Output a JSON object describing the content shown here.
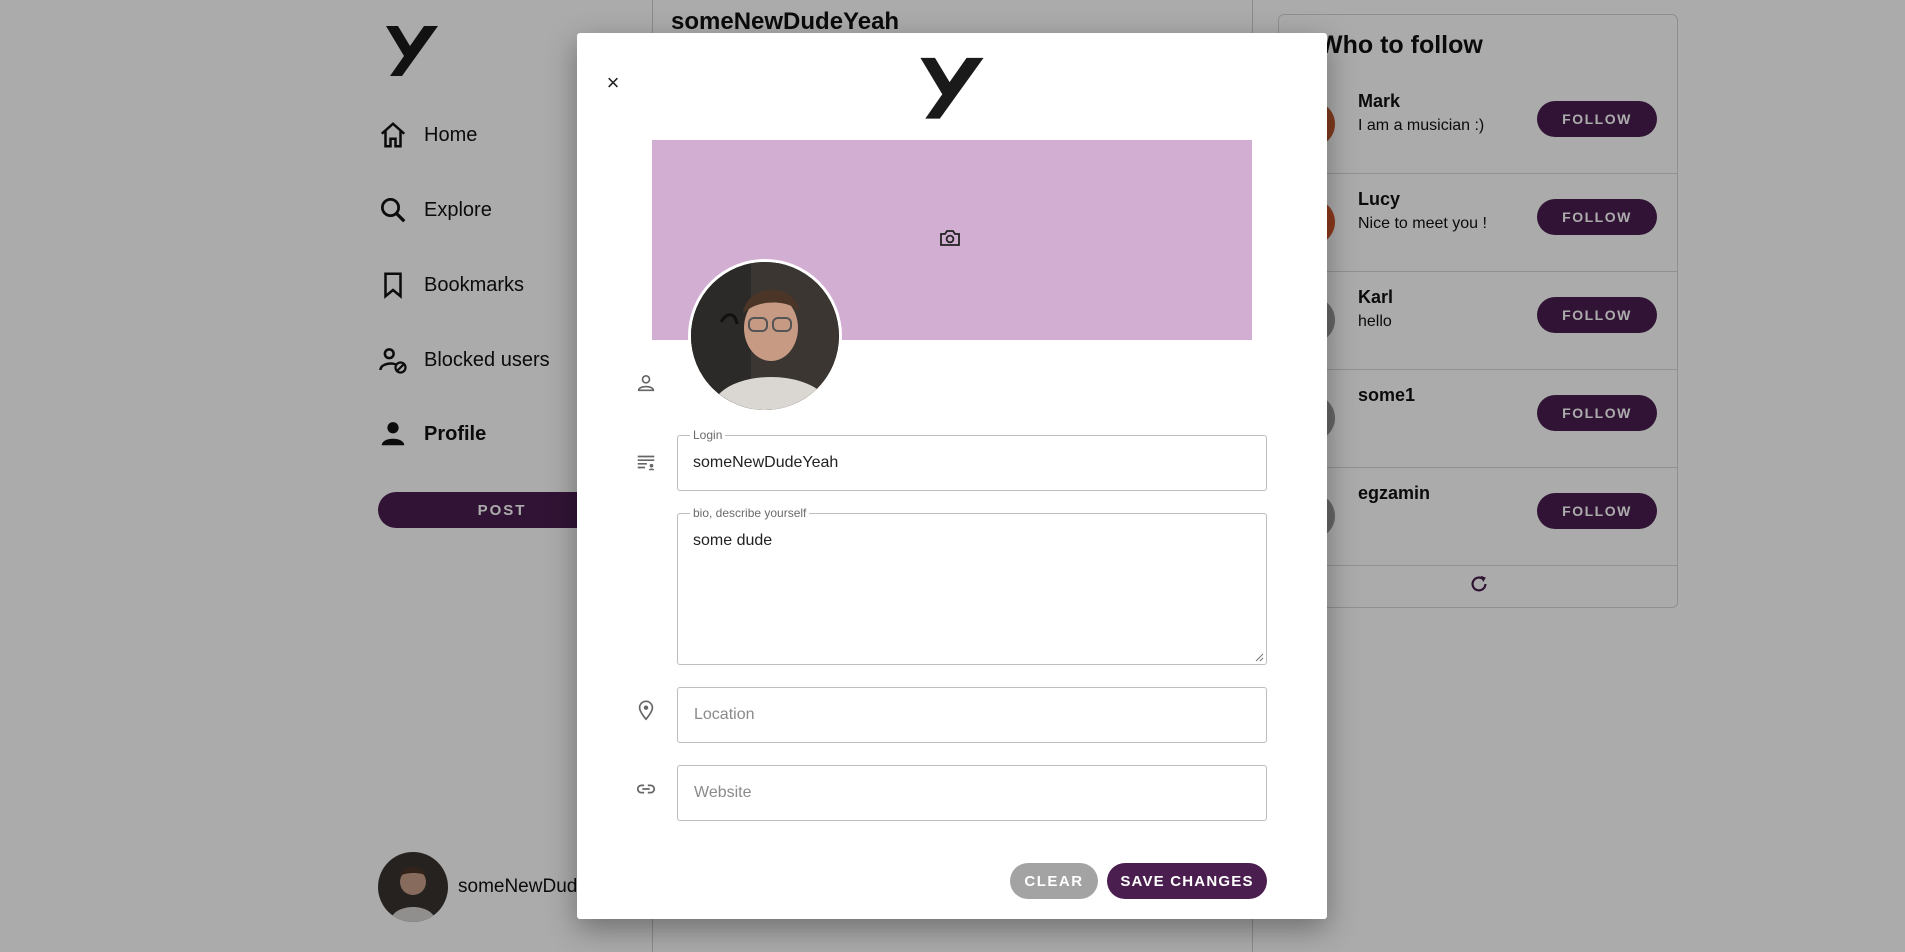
{
  "sidebar": {
    "nav": [
      {
        "label": "Home",
        "icon": "home-icon"
      },
      {
        "label": "Explore",
        "icon": "search-icon"
      },
      {
        "label": "Bookmarks",
        "icon": "bookmark-icon"
      },
      {
        "label": "Blocked users",
        "icon": "blocked-user-icon"
      },
      {
        "label": "Profile",
        "icon": "person-icon",
        "active": true
      }
    ],
    "post_label": "POST",
    "current_user": "someNewDude"
  },
  "main": {
    "profile_title": "someNewDudeYeah"
  },
  "follow_panel": {
    "title": "Who to follow",
    "follow_label": "FOLLOW",
    "suggestions": [
      {
        "name": "Mark",
        "bio": "I am a musician :)"
      },
      {
        "name": "Lucy",
        "bio": "Nice to meet you !"
      },
      {
        "name": "Karl",
        "bio": "hello"
      },
      {
        "name": "some1",
        "bio": ""
      },
      {
        "name": "egzamin",
        "bio": ""
      }
    ]
  },
  "modal": {
    "close_symbol": "×",
    "login": {
      "legend": "Login",
      "value": "someNewDudeYeah"
    },
    "bio": {
      "legend": "bio, describe yourself",
      "value": "some dude"
    },
    "location": {
      "placeholder": "Location",
      "value": ""
    },
    "website": {
      "placeholder": "Website",
      "value": ""
    },
    "clear_label": "CLEAR",
    "save_label": "SAVE CHANGES"
  },
  "colors": {
    "accent": "#4a1f4f",
    "banner": "#d3aed3",
    "clear_button": "#a3a3a3",
    "overlay": "rgba(0,0,0,0.33)"
  }
}
